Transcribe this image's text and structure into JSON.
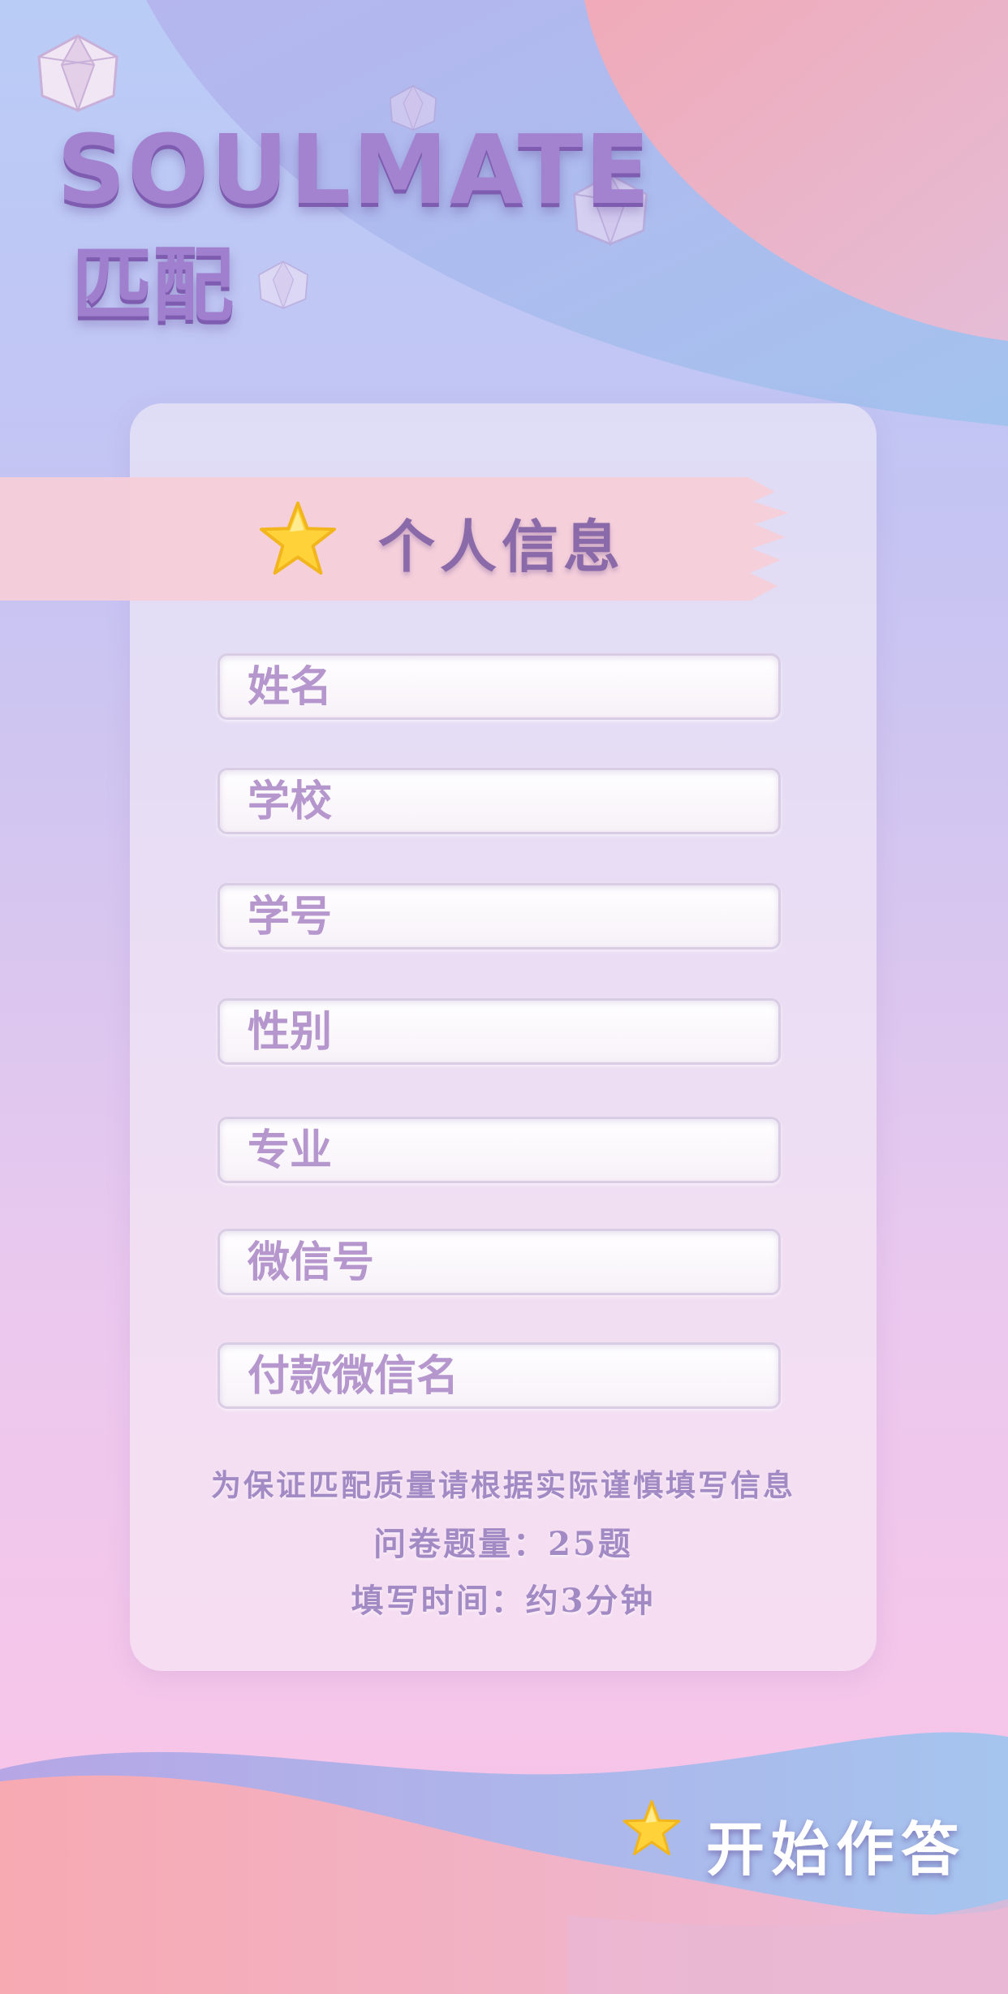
{
  "brand": {
    "logo_text": "SOULMATE",
    "logo_sub": "匹配"
  },
  "section": {
    "title": "个人信息"
  },
  "form": {
    "fields": [
      {
        "placeholder": "姓名"
      },
      {
        "placeholder": "学校"
      },
      {
        "placeholder": "学号"
      },
      {
        "placeholder": "性别"
      },
      {
        "placeholder": "专业"
      },
      {
        "placeholder": "微信号"
      },
      {
        "placeholder": "付款微信名"
      }
    ]
  },
  "notes": {
    "line1": "为保证匹配质量请根据实际谨慎填写信息",
    "line2": "问卷题量：25题",
    "line3": "填写时间：约3分钟"
  },
  "action": {
    "start_label": "开始作答"
  },
  "colors": {
    "accent": "#a382cf",
    "star": "#ffd23a",
    "ribbon": "#f6ced8"
  },
  "icons": [
    "star-icon",
    "crystal-icon"
  ]
}
